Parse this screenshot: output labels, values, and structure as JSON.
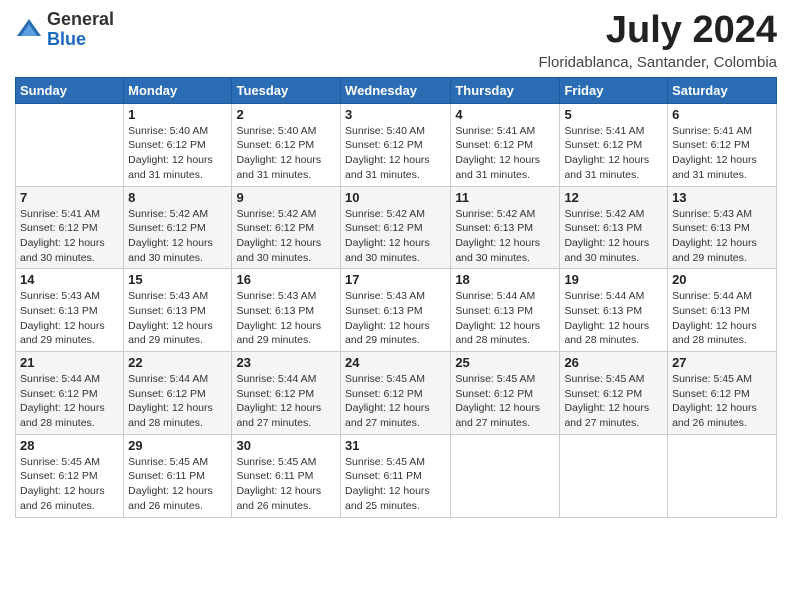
{
  "header": {
    "logo_general": "General",
    "logo_blue": "Blue",
    "month_year": "July 2024",
    "location": "Floridablanca, Santander, Colombia"
  },
  "days_of_week": [
    "Sunday",
    "Monday",
    "Tuesday",
    "Wednesday",
    "Thursday",
    "Friday",
    "Saturday"
  ],
  "weeks": [
    [
      {
        "day": "",
        "info": ""
      },
      {
        "day": "1",
        "info": "Sunrise: 5:40 AM\nSunset: 6:12 PM\nDaylight: 12 hours and 31 minutes."
      },
      {
        "day": "2",
        "info": "Sunrise: 5:40 AM\nSunset: 6:12 PM\nDaylight: 12 hours and 31 minutes."
      },
      {
        "day": "3",
        "info": "Sunrise: 5:40 AM\nSunset: 6:12 PM\nDaylight: 12 hours and 31 minutes."
      },
      {
        "day": "4",
        "info": "Sunrise: 5:41 AM\nSunset: 6:12 PM\nDaylight: 12 hours and 31 minutes."
      },
      {
        "day": "5",
        "info": "Sunrise: 5:41 AM\nSunset: 6:12 PM\nDaylight: 12 hours and 31 minutes."
      },
      {
        "day": "6",
        "info": "Sunrise: 5:41 AM\nSunset: 6:12 PM\nDaylight: 12 hours and 31 minutes."
      }
    ],
    [
      {
        "day": "7",
        "info": "Sunrise: 5:41 AM\nSunset: 6:12 PM\nDaylight: 12 hours and 30 minutes."
      },
      {
        "day": "8",
        "info": "Sunrise: 5:42 AM\nSunset: 6:12 PM\nDaylight: 12 hours and 30 minutes."
      },
      {
        "day": "9",
        "info": "Sunrise: 5:42 AM\nSunset: 6:12 PM\nDaylight: 12 hours and 30 minutes."
      },
      {
        "day": "10",
        "info": "Sunrise: 5:42 AM\nSunset: 6:12 PM\nDaylight: 12 hours and 30 minutes."
      },
      {
        "day": "11",
        "info": "Sunrise: 5:42 AM\nSunset: 6:13 PM\nDaylight: 12 hours and 30 minutes."
      },
      {
        "day": "12",
        "info": "Sunrise: 5:42 AM\nSunset: 6:13 PM\nDaylight: 12 hours and 30 minutes."
      },
      {
        "day": "13",
        "info": "Sunrise: 5:43 AM\nSunset: 6:13 PM\nDaylight: 12 hours and 29 minutes."
      }
    ],
    [
      {
        "day": "14",
        "info": "Sunrise: 5:43 AM\nSunset: 6:13 PM\nDaylight: 12 hours and 29 minutes."
      },
      {
        "day": "15",
        "info": "Sunrise: 5:43 AM\nSunset: 6:13 PM\nDaylight: 12 hours and 29 minutes."
      },
      {
        "day": "16",
        "info": "Sunrise: 5:43 AM\nSunset: 6:13 PM\nDaylight: 12 hours and 29 minutes."
      },
      {
        "day": "17",
        "info": "Sunrise: 5:43 AM\nSunset: 6:13 PM\nDaylight: 12 hours and 29 minutes."
      },
      {
        "day": "18",
        "info": "Sunrise: 5:44 AM\nSunset: 6:13 PM\nDaylight: 12 hours and 28 minutes."
      },
      {
        "day": "19",
        "info": "Sunrise: 5:44 AM\nSunset: 6:13 PM\nDaylight: 12 hours and 28 minutes."
      },
      {
        "day": "20",
        "info": "Sunrise: 5:44 AM\nSunset: 6:13 PM\nDaylight: 12 hours and 28 minutes."
      }
    ],
    [
      {
        "day": "21",
        "info": "Sunrise: 5:44 AM\nSunset: 6:12 PM\nDaylight: 12 hours and 28 minutes."
      },
      {
        "day": "22",
        "info": "Sunrise: 5:44 AM\nSunset: 6:12 PM\nDaylight: 12 hours and 28 minutes."
      },
      {
        "day": "23",
        "info": "Sunrise: 5:44 AM\nSunset: 6:12 PM\nDaylight: 12 hours and 27 minutes."
      },
      {
        "day": "24",
        "info": "Sunrise: 5:45 AM\nSunset: 6:12 PM\nDaylight: 12 hours and 27 minutes."
      },
      {
        "day": "25",
        "info": "Sunrise: 5:45 AM\nSunset: 6:12 PM\nDaylight: 12 hours and 27 minutes."
      },
      {
        "day": "26",
        "info": "Sunrise: 5:45 AM\nSunset: 6:12 PM\nDaylight: 12 hours and 27 minutes."
      },
      {
        "day": "27",
        "info": "Sunrise: 5:45 AM\nSunset: 6:12 PM\nDaylight: 12 hours and 26 minutes."
      }
    ],
    [
      {
        "day": "28",
        "info": "Sunrise: 5:45 AM\nSunset: 6:12 PM\nDaylight: 12 hours and 26 minutes."
      },
      {
        "day": "29",
        "info": "Sunrise: 5:45 AM\nSunset: 6:11 PM\nDaylight: 12 hours and 26 minutes."
      },
      {
        "day": "30",
        "info": "Sunrise: 5:45 AM\nSunset: 6:11 PM\nDaylight: 12 hours and 26 minutes."
      },
      {
        "day": "31",
        "info": "Sunrise: 5:45 AM\nSunset: 6:11 PM\nDaylight: 12 hours and 25 minutes."
      },
      {
        "day": "",
        "info": ""
      },
      {
        "day": "",
        "info": ""
      },
      {
        "day": "",
        "info": ""
      }
    ]
  ]
}
